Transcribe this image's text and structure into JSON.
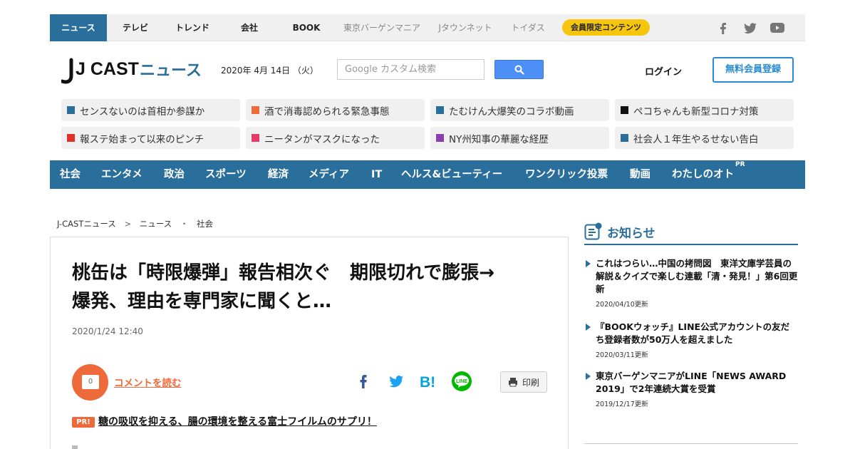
{
  "topnav": {
    "items": [
      {
        "label": "ニュース"
      },
      {
        "label": "テレビ"
      },
      {
        "label": "トレンド"
      },
      {
        "label": "会社"
      },
      {
        "label": "BOOK"
      },
      {
        "label": "東京バーゲンマニア"
      },
      {
        "label": "Jタウンネット"
      },
      {
        "label": "トイダス"
      }
    ],
    "member_pill": "会員限定コンテンツ",
    "social": [
      "facebook-icon",
      "twitter-icon",
      "youtube-icon"
    ]
  },
  "header": {
    "logo_main": "J CAST",
    "logo_sub": "ニュース",
    "date": "2020年 4月 14日 （火）",
    "search_placeholder": "Google カスタム検索",
    "login": "ログイン",
    "register": "無料会員登録"
  },
  "trending": [
    {
      "label": "センスないのは首相か参謀か",
      "color": "#2a6e9c"
    },
    {
      "label": "酒で消毒認められる緊急事態",
      "color": "#ef6a3a"
    },
    {
      "label": "たむけん大爆笑のコラボ動画",
      "color": "#2a6e9c"
    },
    {
      "label": "ペコちゃんも新型コロナ対策",
      "color": "#111111"
    },
    {
      "label": "報ステ始まって以来のピンチ",
      "color": "#e0302a"
    },
    {
      "label": "ニータンがマスクになった",
      "color": "#e83a6a"
    },
    {
      "label": "NY州知事の華麗な経歴",
      "color": "#8a3fb0"
    },
    {
      "label": "社会人１年生やるせない告白",
      "color": "#2a6e9c"
    }
  ],
  "categories": [
    {
      "label": "社会"
    },
    {
      "label": "エンタメ"
    },
    {
      "label": "政治"
    },
    {
      "label": "スポーツ"
    },
    {
      "label": "経済"
    },
    {
      "label": "メディア"
    },
    {
      "label": "IT"
    },
    {
      "label": "ヘルス&ビューティー"
    },
    {
      "label": "ワンクリック投票"
    },
    {
      "label": "動画"
    },
    {
      "label": "わたしのオト"
    }
  ],
  "cat_pr": "PR",
  "breadcrumb": {
    "home": "J-CASTニュース",
    "sep1": ">",
    "section": "ニュース",
    "sep2": "・",
    "sub": "社会"
  },
  "article": {
    "title_line1": "桃缶は「時限爆弾」報告相次ぐ　期限切れで膨張→",
    "title_line2": "爆発、理由を専門家に聞くと…",
    "date": "2020/1/24 12:40",
    "comment_count": "0",
    "comment_link": "コメントを読む",
    "print": "印刷",
    "pr_badge": "PR!",
    "pr_text": "糖の吸収を抑える、腸の環境を整える富士フイルムのサプリ！"
  },
  "sidebar": {
    "title": "お知らせ",
    "news": [
      {
        "text": "これはつらい…中国の拷問図　東洋文庫学芸員の解説＆クイズで楽しむ連載「清・発見！」第6回更新",
        "date": "2020/04/10更新"
      },
      {
        "text": "『BOOKウォッチ』LINE公式アカウントの友だち登録者数が50万人を超えました",
        "date": "2020/03/11更新"
      },
      {
        "text": "東京バーゲンマニアがLINE「NEWS AWARD 2019」で2年連続大賞を受賞",
        "date": "2019/12/17更新"
      }
    ]
  },
  "colors": {
    "brand": "#2a6e9c",
    "accent": "#ef6a3a",
    "pill": "#f6c60f",
    "register": "#2a8ad1"
  }
}
